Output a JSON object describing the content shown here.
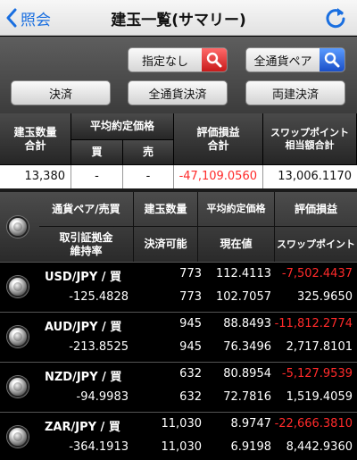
{
  "nav": {
    "back_label": "照会",
    "title": "建玉一覧(サマリー)"
  },
  "toolbar": {
    "filter_designation": "指定なし",
    "filter_pair": "全通貨ペア",
    "btn_settle": "決済",
    "btn_all_settle": "全通貨決済",
    "btn_both_settle": "両建決済"
  },
  "summary": {
    "head_qty_line1": "建玉数量",
    "head_qty_line2": "合計",
    "head_avg": "平均約定価格",
    "head_buy": "買",
    "head_sell": "売",
    "head_pl_line1": "評価損益",
    "head_pl_line2": "合計",
    "head_swap_line1": "スワップポイント",
    "head_swap_line2": "相当額合計",
    "qty": "13,380",
    "avg_buy": "-",
    "avg_sell": "-",
    "pl": "-47,109.0560",
    "swap": "13,006.1170"
  },
  "list_header": {
    "pair_side": "通貨ペア/売買",
    "qty": "建玉数量",
    "avg": "平均約定価格",
    "pl": "評価損益",
    "margin_line1": "取引証拠金",
    "margin_line2": "維持率",
    "available": "決済可能",
    "current": "現在値",
    "swap": "スワップポイント"
  },
  "positions": [
    {
      "pair": "USD/JPY / 買",
      "qty": "773",
      "avg": "112.4113",
      "pl": "-7,502.4437",
      "margin": "-125.4828",
      "available": "773",
      "current": "102.7057",
      "swap": "325.9650"
    },
    {
      "pair": "AUD/JPY / 買",
      "qty": "945",
      "avg": "88.8493",
      "pl": "-11,812.2774",
      "margin": "-213.8525",
      "available": "945",
      "current": "76.3496",
      "swap": "2,717.8101"
    },
    {
      "pair": "NZD/JPY / 買",
      "qty": "632",
      "avg": "80.8954",
      "pl": "-5,127.9539",
      "margin": "-94.9983",
      "available": "632",
      "current": "72.7816",
      "swap": "1,519.4059"
    },
    {
      "pair": "ZAR/JPY / 買",
      "qty": "11,030",
      "avg": "8.9747",
      "pl": "-22,666.3810",
      "margin": "-364.1913",
      "available": "11,030",
      "current": "6.9198",
      "swap": "8,442.9360"
    }
  ],
  "colors": {
    "negative": "#ff2a2a",
    "nav_blue": "#1a6fe0"
  }
}
